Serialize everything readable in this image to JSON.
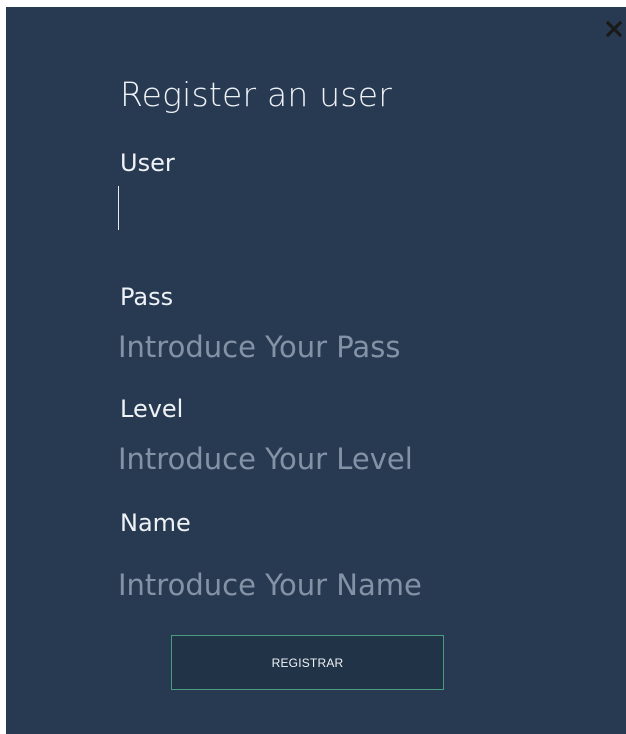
{
  "dialog": {
    "title": "Register an user",
    "close_icon": "close-icon"
  },
  "form": {
    "user": {
      "label": "User",
      "value": "",
      "placeholder": ""
    },
    "pass": {
      "label": "Pass",
      "value": "",
      "placeholder": "Introduce Your Pass"
    },
    "level": {
      "label": "Level",
      "value": "",
      "placeholder": "Introduce Your Level"
    },
    "name": {
      "label": "Name",
      "value": "",
      "placeholder": "Introduce Your Name"
    },
    "submit_label": "REGISTRAR"
  },
  "colors": {
    "background": "#283a52",
    "placeholder": "#8492a6",
    "button_border": "#4a9c80",
    "button_fill": "#213346"
  }
}
